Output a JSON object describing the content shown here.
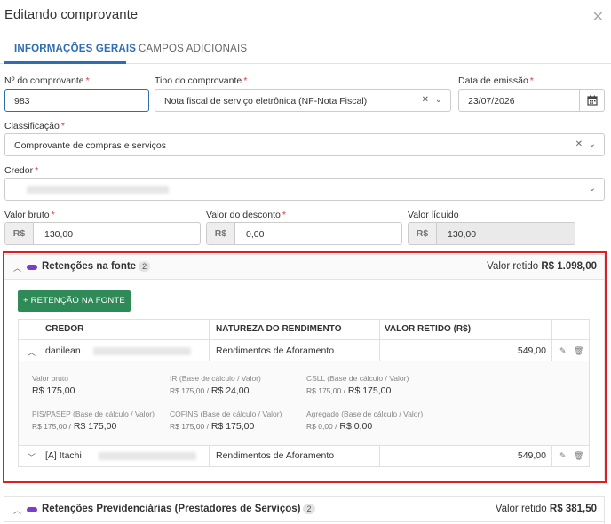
{
  "modal": {
    "title": "Editando comprovante",
    "close_glyph": "✕"
  },
  "tabs": [
    {
      "label": "INFORMAÇÕES GERAIS",
      "active": true
    },
    {
      "label": "CAMPOS ADICIONAIS",
      "active": false
    }
  ],
  "form": {
    "numero": {
      "label": "Nº do comprovante",
      "value": "983"
    },
    "tipo": {
      "label": "Tipo do comprovante",
      "value": "Nota fiscal de serviço eletrônica (NF-Nota Fiscal)"
    },
    "data": {
      "label": "Data de emissão",
      "value": "23/07/2026"
    },
    "classificacao": {
      "label": "Classificação",
      "value": "Comprovante de compras e serviços"
    },
    "credor": {
      "label": "Credor",
      "value": ""
    },
    "valor_bruto": {
      "label": "Valor bruto",
      "prefix": "R$",
      "value": "130,00"
    },
    "valor_desconto": {
      "label": "Valor do desconto",
      "prefix": "R$",
      "value": "0,00"
    },
    "valor_liquido": {
      "label": "Valor líquido",
      "prefix": "R$",
      "value": "130,00"
    },
    "required_mark": "*"
  },
  "retencoes_fonte": {
    "title": "Retenções na fonte",
    "count": "2",
    "retido_label": "Valor retido",
    "retido_value": "R$ 1.098,00",
    "add_button": "+ RETENÇÃO NA FONTE",
    "columns": [
      "CREDOR",
      "NATUREZA DO RENDIMENTO",
      "VALOR RETIDO (R$)"
    ],
    "rows": [
      {
        "credor": "danilean",
        "natureza": "Rendimentos de Aforamento",
        "valor": "549,00",
        "expanded": true,
        "details": [
          {
            "label": "Valor bruto",
            "base": "",
            "value": "R$ 175,00"
          },
          {
            "label": "IR (Base de cálculo / Valor)",
            "base": "R$ 175,00 /",
            "value": "R$ 24,00"
          },
          {
            "label": "CSLL (Base de cálculo / Valor)",
            "base": "R$ 175,00 /",
            "value": "R$ 175,00"
          },
          {
            "label": "PIS/PASEP (Base de cálculo / Valor)",
            "base": "R$ 175,00 /",
            "value": "R$ 175,00"
          },
          {
            "label": "COFINS (Base de cálculo / Valor)",
            "base": "R$ 175,00 /",
            "value": "R$ 175,00"
          },
          {
            "label": "Agregado (Base de cálculo / Valor)",
            "base": "R$ 0,00 /",
            "value": "R$ 0,00"
          }
        ]
      },
      {
        "credor": "[A] Itachi",
        "natureza": "Rendimentos de Aforamento",
        "valor": "549,00",
        "expanded": false
      }
    ]
  },
  "retencoes_prev": {
    "title": "Retenções Previdenciárias (Prestadores de Serviços)",
    "count": "2",
    "retido_label": "Valor retido",
    "retido_value": "R$ 381,50"
  },
  "colors": {
    "accent": "#2e6db4",
    "highlight": "#e11d22",
    "button_green": "#2e8b57",
    "pill": "#7b3fc7",
    "required": "#e03a3a"
  }
}
